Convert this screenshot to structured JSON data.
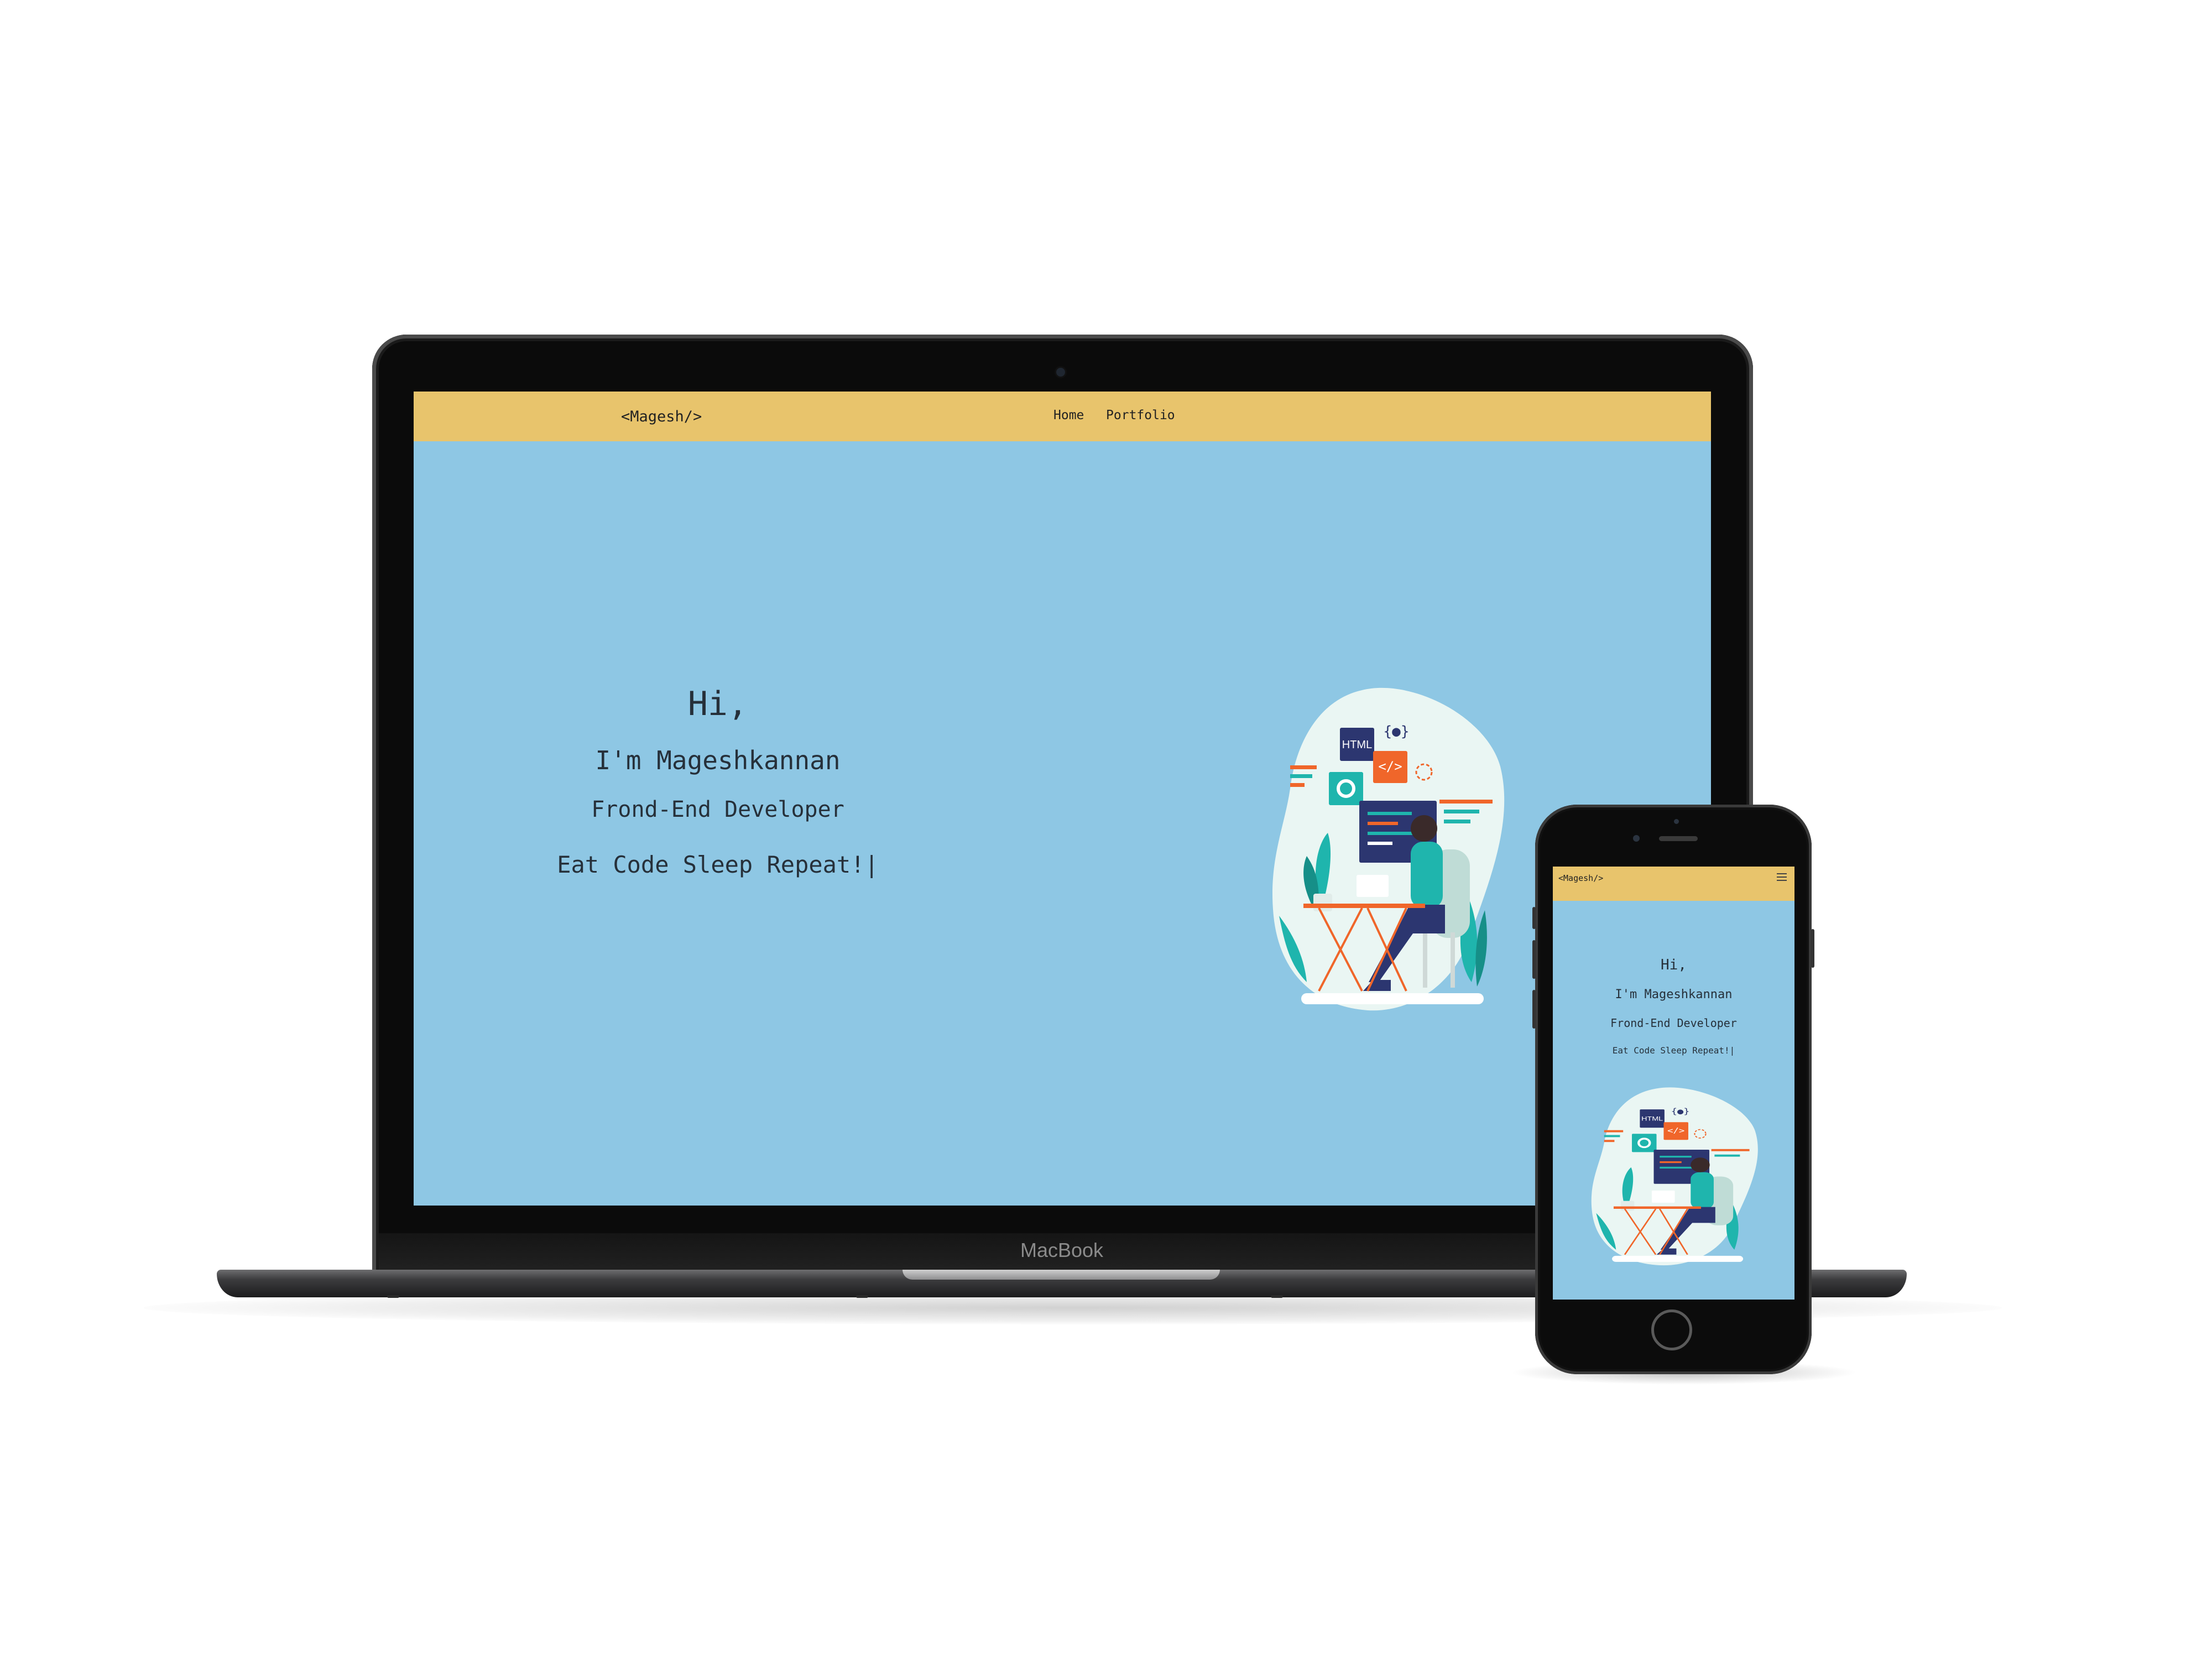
{
  "laptop": {
    "brand_label": "MacBook"
  },
  "desktop_site": {
    "logo": "<Magesh/>",
    "nav_items": [
      "Home",
      "Portfolio"
    ],
    "hero": {
      "greeting": "Hi,",
      "name_line": "I'm Mageshkannan",
      "role": "Frond-End Developer",
      "tagline": "Eat Code Sleep Repeat!|"
    },
    "illustration": {
      "icon": "developer-at-desk-illustration",
      "badge_text": "HTML",
      "code_glyph": "</>",
      "brace_glyph": "{●}"
    }
  },
  "mobile_site": {
    "logo": "<Magesh/>",
    "menu_icon": "hamburger-menu-icon",
    "hero": {
      "greeting": "Hi,",
      "name_line": "I'm Mageshkannan",
      "role": "Frond-End Developer",
      "tagline": "Eat Code Sleep Repeat!|"
    },
    "illustration": {
      "icon": "developer-at-desk-illustration",
      "badge_text": "HTML",
      "code_glyph": "</>",
      "brace_glyph": "{●}"
    }
  },
  "colors": {
    "page_background": "#ffffff",
    "navbar": "#e8c46c",
    "hero_background": "#8ec7e4",
    "text": "#26303a",
    "accent_orange": "#f0662a",
    "accent_teal": "#1fb5ad",
    "accent_navy": "#2c3670"
  }
}
